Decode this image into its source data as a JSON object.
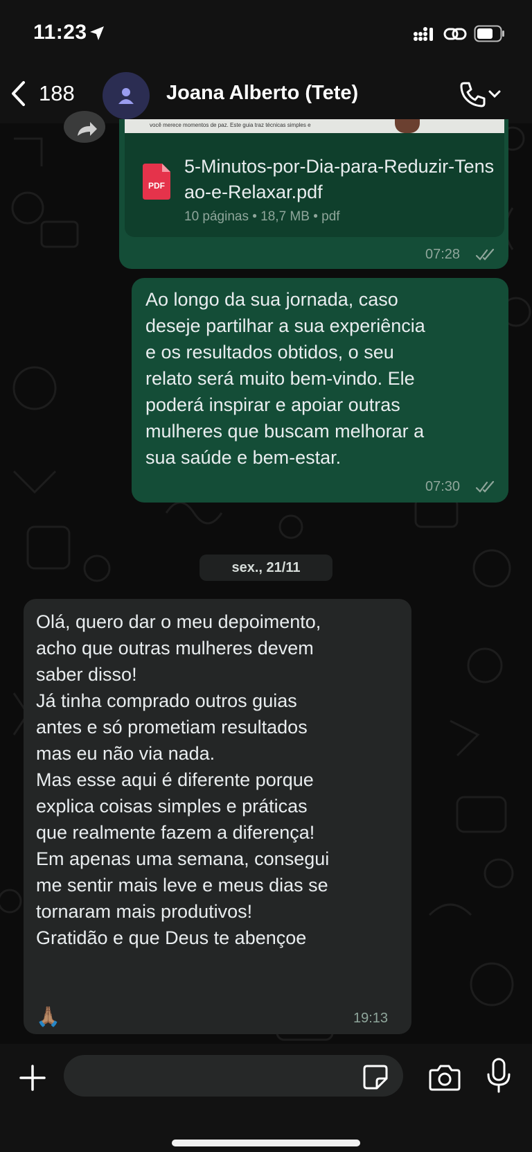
{
  "status_bar": {
    "time": "11:23"
  },
  "header": {
    "back_count": "188",
    "contact_name": "Joana Alberto (Tete)"
  },
  "messages": {
    "document": {
      "preview_text": "você merece momentos de paz. Este guia traz técnicas simples e",
      "file_name": "5-Minutos-por-Dia-para-Reduzir-Tensao-e-Relaxar.pdf",
      "meta": "10 páginas • 18,7 MB • pdf",
      "icon_label": "PDF",
      "time": "07:28"
    },
    "outgoing_text": {
      "text": "Ao longo da sua jornada, caso\ndeseje partilhar a sua experiência\ne os resultados obtidos, o seu\nrelato será muito bem-vindo. Ele\npoderá inspirar e apoiar outras\nmulheres que buscam melhorar a\nsua saúde e bem-estar.",
      "time": "07:30"
    },
    "date_separator": "sex., 21/11",
    "incoming_text": {
      "text": "Olá, quero dar o meu depoimento,\nacho que outras mulheres devem\nsaber disso!\nJá tinha comprado outros guias\nantes e só prometiam resultados\nmas eu não via nada.\nMas esse aqui é diferente porque\nexplica coisas simples e práticas\nque realmente fazem a diferença!\nEm apenas uma semana, consegui\nme sentir mais leve e meus dias se\ntornaram mais produtivos!\nGratidão e que Deus te abençoe",
      "emoji": "🙏🏽",
      "time": "19:13"
    }
  },
  "composer": {
    "placeholder": ""
  },
  "colors": {
    "outgoing_bubble": "#144d37",
    "incoming_bubble": "#242626",
    "background": "#0c0c0c",
    "read_ticks": "#8fa69b"
  },
  "icons": [
    "location-arrow-icon",
    "signal-icon",
    "link-icon",
    "battery-icon",
    "chevron-left-icon",
    "person-icon",
    "phone-icon",
    "chevron-down-icon",
    "forward-icon",
    "pdf-icon",
    "double-check-icon",
    "plus-icon",
    "sticker-icon",
    "camera-icon",
    "microphone-icon"
  ]
}
